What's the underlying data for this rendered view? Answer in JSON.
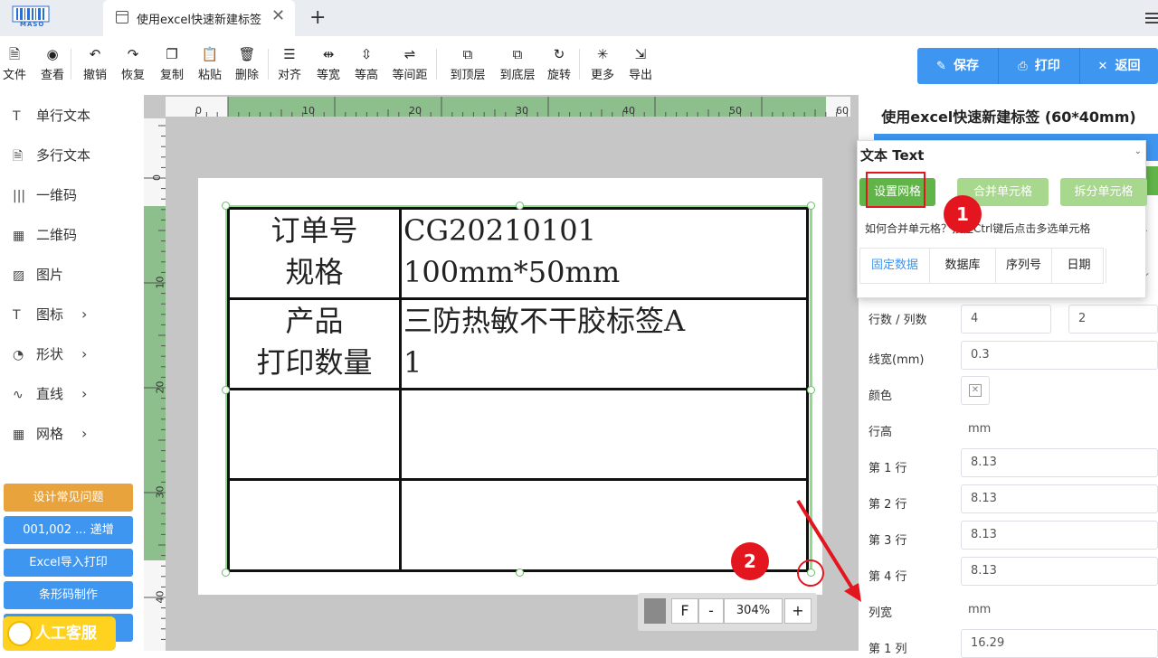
{
  "tab": {
    "title": "使用excel快速新建标签",
    "close": "✕",
    "new": "+"
  },
  "logo": {
    "text": "MASO"
  },
  "toolbar": [
    {
      "label": "文件",
      "icon": "file-icon",
      "glyph": "🗎"
    },
    {
      "label": "查看",
      "icon": "eye-icon",
      "glyph": "◉"
    },
    {
      "label": "撤销",
      "icon": "undo-icon",
      "glyph": "↶"
    },
    {
      "label": "恢复",
      "icon": "redo-icon",
      "glyph": "↷"
    },
    {
      "label": "复制",
      "icon": "copy-icon",
      "glyph": "❐"
    },
    {
      "label": "粘贴",
      "icon": "paste-icon",
      "glyph": "📋"
    },
    {
      "label": "删除",
      "icon": "trash-icon",
      "glyph": "🗑"
    },
    {
      "label": "对齐",
      "icon": "align-icon",
      "glyph": "☰"
    },
    {
      "label": "等宽",
      "icon": "equal-width-icon",
      "glyph": "⇹"
    },
    {
      "label": "等高",
      "icon": "equal-height-icon",
      "glyph": "⇳"
    },
    {
      "label": "等间距",
      "icon": "equal-spacing-icon",
      "glyph": "⇌"
    },
    {
      "label": "到顶层",
      "icon": "bring-front-icon",
      "glyph": "⧉"
    },
    {
      "label": "到底层",
      "icon": "send-back-icon",
      "glyph": "⧉"
    },
    {
      "label": "旋转",
      "icon": "rotate-icon",
      "glyph": "↻"
    },
    {
      "label": "更多",
      "icon": "more-icon",
      "glyph": "✳"
    },
    {
      "label": "导出",
      "icon": "export-icon",
      "glyph": "⇲"
    }
  ],
  "actions": {
    "save": "保存",
    "print": "打印",
    "back": "返回",
    "save_icon": "✎",
    "print_icon": "⎙",
    "back_icon": "✕"
  },
  "sidebar": [
    {
      "label": "单行文本",
      "icon": "text-icon",
      "glyph": "T",
      "arrow": ""
    },
    {
      "label": "多行文本",
      "icon": "multiline-text-icon",
      "glyph": "🗎",
      "arrow": ""
    },
    {
      "label": "一维码",
      "icon": "barcode-icon",
      "glyph": "|||",
      "arrow": ""
    },
    {
      "label": "二维码",
      "icon": "qrcode-icon",
      "glyph": "▦",
      "arrow": ""
    },
    {
      "label": "图片",
      "icon": "image-icon",
      "glyph": "▨",
      "arrow": ""
    },
    {
      "label": "图标",
      "icon": "icon-icon",
      "glyph": "T",
      "arrow": "›"
    },
    {
      "label": "形状",
      "icon": "shape-icon",
      "glyph": "◔",
      "arrow": "›"
    },
    {
      "label": "直线",
      "icon": "line-icon",
      "glyph": "∿",
      "arrow": "›"
    },
    {
      "label": "网格",
      "icon": "grid-icon",
      "glyph": "▦",
      "arrow": "›"
    }
  ],
  "left_buttons": [
    {
      "label": "设计常见问题",
      "color": "#e8a33d"
    },
    {
      "label": "001,002 ... 递增",
      "color": "#3f96f0"
    },
    {
      "label": "Excel导入打印",
      "color": "#3f96f0"
    },
    {
      "label": "条形码制作",
      "color": "#3f96f0"
    },
    {
      "label": "",
      "color": "#3f96f0"
    }
  ],
  "kefu": "人工客服",
  "ruler": {
    "h_ticks": [
      "0",
      "10",
      "20",
      "30",
      "40",
      "50",
      "60"
    ],
    "v_ticks": [
      "0",
      "10",
      "20",
      "30",
      "40"
    ]
  },
  "label_table": {
    "rows": [
      [
        "订单号\n规格",
        "CG20210101\n100mm*50mm"
      ],
      [
        "产品\n打印数量",
        "三防热敏不干胶标签A\n1"
      ],
      [
        "",
        ""
      ],
      [
        "",
        ""
      ]
    ]
  },
  "zoom": {
    "fit": "F",
    "minus": "-",
    "value": "304%",
    "plus": "+"
  },
  "markers": {
    "one": "1",
    "two": "2"
  },
  "right": {
    "title": "使用excel快速新建标签 (60*40mm)",
    "rows_cols_label": "行数 / 列数",
    "rows": "4",
    "cols": "2",
    "line_width_label": "线宽(mm)",
    "line_width": "0.3",
    "color_label": "颜色",
    "color_icon": "✕",
    "row_height_label": "行高",
    "row_height_unit": "mm",
    "row_heights": [
      {
        "label": "第 1 行",
        "value": "8.13"
      },
      {
        "label": "第 2 行",
        "value": "8.13"
      },
      {
        "label": "第 3 行",
        "value": "8.13"
      },
      {
        "label": "第 4 行",
        "value": "8.13"
      }
    ],
    "col_width_label": "列宽",
    "col_width_unit": "mm",
    "col_widths": [
      {
        "label": "第 1 列",
        "value": "16.29"
      }
    ]
  },
  "popup": {
    "title": "文本 Text",
    "chevron": "⌄",
    "set_grid": "设置网格",
    "merge": "合并单元格",
    "split": "拆分单元格",
    "hint": "如何合并单元格？按住Ctrl键后点击多选单元格",
    "tabs": [
      "固定数据",
      "数据库",
      "序列号",
      "日期"
    ]
  },
  "colors": {
    "accent": "#3f96f0",
    "green": "#61b548",
    "red": "#e3161f",
    "orange": "#e8a33d",
    "yellow": "#ffd21f"
  }
}
